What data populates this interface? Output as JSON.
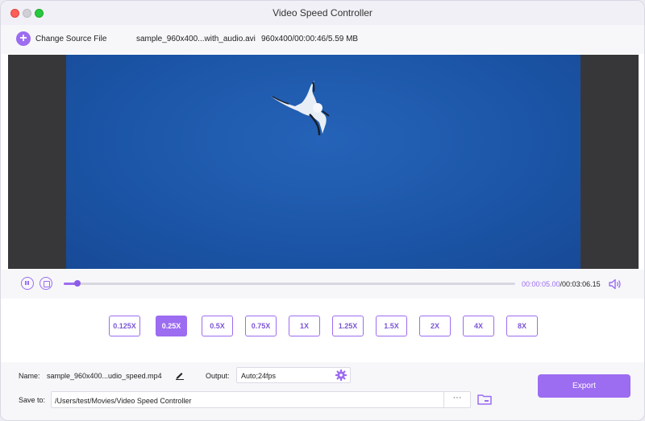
{
  "window": {
    "title": "Video Speed Controller"
  },
  "source": {
    "change_label": "Change Source File",
    "file_name": "sample_960x400...with_audio.avi",
    "file_info": "960x400/00:00:46/5.59 MB"
  },
  "player": {
    "current_time": "00:00:05.00",
    "total_time": "/00:03:06.15",
    "progress": 0.03
  },
  "speeds": [
    {
      "label": "0.125X",
      "active": false
    },
    {
      "label": "0.25X",
      "active": true
    },
    {
      "label": "0.5X",
      "active": false
    },
    {
      "label": "0.75X",
      "active": false
    },
    {
      "label": "1X",
      "active": false
    },
    {
      "label": "1.25X",
      "active": false
    },
    {
      "label": "1.5X",
      "active": false
    },
    {
      "label": "2X",
      "active": false
    },
    {
      "label": "4X",
      "active": false
    },
    {
      "label": "8X",
      "active": false
    }
  ],
  "settings": {
    "name_label": "Name:",
    "name_value": "sample_960x400...udio_speed.mp4",
    "output_label": "Output:",
    "output_value": "Auto;24fps",
    "save_label": "Save to:",
    "save_path": "/Users/test/Movies/Video Speed Controller",
    "more_label": "···",
    "export_label": "Export"
  },
  "colors": {
    "accent": "#9c6cf1",
    "video_bg": "#1c56a8",
    "letterbox": "#373739"
  },
  "icons": {
    "add": "plus-circle-icon",
    "pause": "pause-icon",
    "stop": "stop-icon",
    "volume": "volume-icon",
    "edit": "pencil-icon",
    "gear": "gear-icon",
    "folder": "folder-icon"
  }
}
